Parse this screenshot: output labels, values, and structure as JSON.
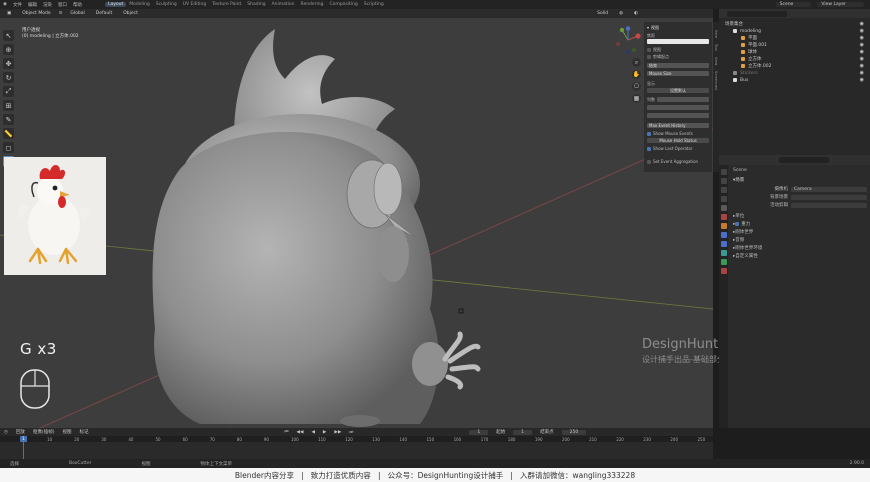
{
  "topbar": {
    "menus": [
      "文件",
      "编辑",
      "渲染",
      "窗口",
      "帮助"
    ],
    "workspaces": [
      "Layout",
      "Modeling",
      "Sculpting",
      "UV Editing",
      "Texture Paint",
      "Shading",
      "Animation",
      "Rendering",
      "Compositing",
      "Scripting"
    ],
    "active_workspace": "Layout",
    "scene": "Scene",
    "view_layer": "View Layer"
  },
  "viewport_header": {
    "mode": "Object Mode",
    "global": "Global",
    "view": "Default",
    "select": "Object",
    "shading": "Solid"
  },
  "viewport_info": {
    "line1": "用户透视",
    "line2": "(0) modeling | 立方体.002"
  },
  "overlay": {
    "hotkey": "G x3",
    "watermark_title": "DesignHunting",
    "watermark_sub": "设计捕手出品-基础部分"
  },
  "npanel": {
    "section": "视图",
    "items": [
      "焦距",
      "视图",
      "剪辑起点",
      "结束",
      "Mouse Size",
      "显示",
      "设置默认",
      "列数",
      "Max Event History",
      "Show Mouse Events",
      "Mouse Hold Status",
      "Show Last Operator",
      "Set Event Aggregation"
    ],
    "tabs": [
      "Item",
      "Tool",
      "View",
      "Screencast"
    ]
  },
  "outliner": {
    "title": "场景集合",
    "items": [
      {
        "label": "modeling"
      },
      {
        "label": "平面"
      },
      {
        "label": "平面.001"
      },
      {
        "label": "球体"
      },
      {
        "label": "立方体"
      },
      {
        "label": "立方体.002"
      },
      {
        "label": "Stickers"
      },
      {
        "label": "Bus"
      }
    ]
  },
  "properties": {
    "scene_name": "Scene",
    "section_scene": "场景",
    "camera_label": "摄像机",
    "camera_value": "Camera",
    "bg_scene": "背景场景",
    "active_clip": "活动剪辑",
    "sections": [
      "单位",
      "重力",
      "刚体世界",
      "音频",
      "刚体世界环境",
      "自定义属性"
    ]
  },
  "timeline": {
    "labels": [
      "回放",
      "抠像(插帧)",
      "视图",
      "标记"
    ],
    "ticks": [
      "0",
      "10",
      "20",
      "30",
      "40",
      "50",
      "60",
      "70",
      "80",
      "90",
      "100",
      "110",
      "120",
      "130",
      "140",
      "150",
      "160",
      "170",
      "180",
      "190",
      "200",
      "210",
      "220",
      "230",
      "240",
      "250"
    ],
    "current_frame": "1",
    "start_label": "起始",
    "start": "1",
    "end_label": "结束点",
    "end": "250"
  },
  "status": {
    "items": [
      "选择",
      "BoxCutter",
      "视图",
      "物体上下文菜单"
    ],
    "version": "2.90.0"
  },
  "caption": "Blender内容分享   |   致力打造优质内容   |   公众号：DesignHunting设计捕手   |   入群请加微信：wangling333228"
}
